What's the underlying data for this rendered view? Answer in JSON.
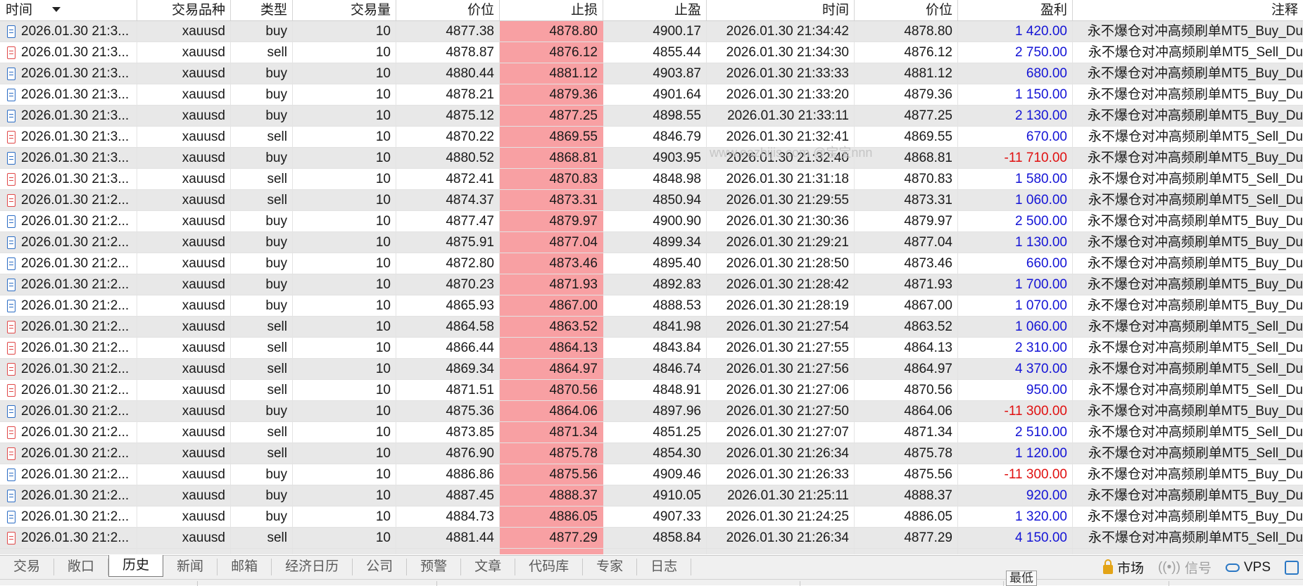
{
  "columns": {
    "time": "时间",
    "symbol": "交易品种",
    "type": "类型",
    "volume": "交易量",
    "price": "价位",
    "sl": "止损",
    "tp": "止盈",
    "close_time": "时间",
    "close_price": "价位",
    "profit": "盈利",
    "comment": "注释"
  },
  "watermark": "www.eazhijis.com @宝宝nnn",
  "rows": [
    {
      "time": "2026.01.30 21:3...",
      "symbol": "xauusd",
      "type": "buy",
      "volume": "10",
      "price": "4877.38",
      "sl": "4878.80",
      "tp": "4900.17",
      "close_time": "2026.01.30 21:34:42",
      "close_price": "4878.80",
      "profit": "1 420.00",
      "comment": "永不爆仓对冲高频刷单MT5_Buy_Du"
    },
    {
      "time": "2026.01.30 21:3...",
      "symbol": "xauusd",
      "type": "sell",
      "volume": "10",
      "price": "4878.87",
      "sl": "4876.12",
      "tp": "4855.44",
      "close_time": "2026.01.30 21:34:30",
      "close_price": "4876.12",
      "profit": "2 750.00",
      "comment": "永不爆仓对冲高频刷单MT5_Sell_Du"
    },
    {
      "time": "2026.01.30 21:3...",
      "symbol": "xauusd",
      "type": "buy",
      "volume": "10",
      "price": "4880.44",
      "sl": "4881.12",
      "tp": "4903.87",
      "close_time": "2026.01.30 21:33:33",
      "close_price": "4881.12",
      "profit": "680.00",
      "comment": "永不爆仓对冲高频刷单MT5_Buy_Du"
    },
    {
      "time": "2026.01.30 21:3...",
      "symbol": "xauusd",
      "type": "buy",
      "volume": "10",
      "price": "4878.21",
      "sl": "4879.36",
      "tp": "4901.64",
      "close_time": "2026.01.30 21:33:20",
      "close_price": "4879.36",
      "profit": "1 150.00",
      "comment": "永不爆仓对冲高频刷单MT5_Buy_Du"
    },
    {
      "time": "2026.01.30 21:3...",
      "symbol": "xauusd",
      "type": "buy",
      "volume": "10",
      "price": "4875.12",
      "sl": "4877.25",
      "tp": "4898.55",
      "close_time": "2026.01.30 21:33:11",
      "close_price": "4877.25",
      "profit": "2 130.00",
      "comment": "永不爆仓对冲高频刷单MT5_Buy_Du"
    },
    {
      "time": "2026.01.30 21:3...",
      "symbol": "xauusd",
      "type": "sell",
      "volume": "10",
      "price": "4870.22",
      "sl": "4869.55",
      "tp": "4846.79",
      "close_time": "2026.01.30 21:32:41",
      "close_price": "4869.55",
      "profit": "670.00",
      "comment": "永不爆仓对冲高频刷单MT5_Sell_Du"
    },
    {
      "time": "2026.01.30 21:3...",
      "symbol": "xauusd",
      "type": "buy",
      "volume": "10",
      "price": "4880.52",
      "sl": "4868.81",
      "tp": "4903.95",
      "close_time": "2026.01.30 21:32:40",
      "close_price": "4868.81",
      "profit": "-11 710.00",
      "comment": "永不爆仓对冲高频刷单MT5_Buy_Du"
    },
    {
      "time": "2026.01.30 21:3...",
      "symbol": "xauusd",
      "type": "sell",
      "volume": "10",
      "price": "4872.41",
      "sl": "4870.83",
      "tp": "4848.98",
      "close_time": "2026.01.30 21:31:18",
      "close_price": "4870.83",
      "profit": "1 580.00",
      "comment": "永不爆仓对冲高频刷单MT5_Sell_Du"
    },
    {
      "time": "2026.01.30 21:2...",
      "symbol": "xauusd",
      "type": "sell",
      "volume": "10",
      "price": "4874.37",
      "sl": "4873.31",
      "tp": "4850.94",
      "close_time": "2026.01.30 21:29:55",
      "close_price": "4873.31",
      "profit": "1 060.00",
      "comment": "永不爆仓对冲高频刷单MT5_Sell_Du"
    },
    {
      "time": "2026.01.30 21:2...",
      "symbol": "xauusd",
      "type": "buy",
      "volume": "10",
      "price": "4877.47",
      "sl": "4879.97",
      "tp": "4900.90",
      "close_time": "2026.01.30 21:30:36",
      "close_price": "4879.97",
      "profit": "2 500.00",
      "comment": "永不爆仓对冲高频刷单MT5_Buy_Du"
    },
    {
      "time": "2026.01.30 21:2...",
      "symbol": "xauusd",
      "type": "buy",
      "volume": "10",
      "price": "4875.91",
      "sl": "4877.04",
      "tp": "4899.34",
      "close_time": "2026.01.30 21:29:21",
      "close_price": "4877.04",
      "profit": "1 130.00",
      "comment": "永不爆仓对冲高频刷单MT5_Buy_Du"
    },
    {
      "time": "2026.01.30 21:2...",
      "symbol": "xauusd",
      "type": "buy",
      "volume": "10",
      "price": "4872.80",
      "sl": "4873.46",
      "tp": "4895.40",
      "close_time": "2026.01.30 21:28:50",
      "close_price": "4873.46",
      "profit": "660.00",
      "comment": "永不爆仓对冲高频刷单MT5_Buy_Du"
    },
    {
      "time": "2026.01.30 21:2...",
      "symbol": "xauusd",
      "type": "buy",
      "volume": "10",
      "price": "4870.23",
      "sl": "4871.93",
      "tp": "4892.83",
      "close_time": "2026.01.30 21:28:42",
      "close_price": "4871.93",
      "profit": "1 700.00",
      "comment": "永不爆仓对冲高频刷单MT5_Buy_Du"
    },
    {
      "time": "2026.01.30 21:2...",
      "symbol": "xauusd",
      "type": "buy",
      "volume": "10",
      "price": "4865.93",
      "sl": "4867.00",
      "tp": "4888.53",
      "close_time": "2026.01.30 21:28:19",
      "close_price": "4867.00",
      "profit": "1 070.00",
      "comment": "永不爆仓对冲高频刷单MT5_Buy_Du"
    },
    {
      "time": "2026.01.30 21:2...",
      "symbol": "xauusd",
      "type": "sell",
      "volume": "10",
      "price": "4864.58",
      "sl": "4863.52",
      "tp": "4841.98",
      "close_time": "2026.01.30 21:27:54",
      "close_price": "4863.52",
      "profit": "1 060.00",
      "comment": "永不爆仓对冲高频刷单MT5_Sell_Du"
    },
    {
      "time": "2026.01.30 21:2...",
      "symbol": "xauusd",
      "type": "sell",
      "volume": "10",
      "price": "4866.44",
      "sl": "4864.13",
      "tp": "4843.84",
      "close_time": "2026.01.30 21:27:55",
      "close_price": "4864.13",
      "profit": "2 310.00",
      "comment": "永不爆仓对冲高频刷单MT5_Sell_Du"
    },
    {
      "time": "2026.01.30 21:2...",
      "symbol": "xauusd",
      "type": "sell",
      "volume": "10",
      "price": "4869.34",
      "sl": "4864.97",
      "tp": "4846.74",
      "close_time": "2026.01.30 21:27:56",
      "close_price": "4864.97",
      "profit": "4 370.00",
      "comment": "永不爆仓对冲高频刷单MT5_Sell_Du"
    },
    {
      "time": "2026.01.30 21:2...",
      "symbol": "xauusd",
      "type": "sell",
      "volume": "10",
      "price": "4871.51",
      "sl": "4870.56",
      "tp": "4848.91",
      "close_time": "2026.01.30 21:27:06",
      "close_price": "4870.56",
      "profit": "950.00",
      "comment": "永不爆仓对冲高频刷单MT5_Sell_Du"
    },
    {
      "time": "2026.01.30 21:2...",
      "symbol": "xauusd",
      "type": "buy",
      "volume": "10",
      "price": "4875.36",
      "sl": "4864.06",
      "tp": "4897.96",
      "close_time": "2026.01.30 21:27:50",
      "close_price": "4864.06",
      "profit": "-11 300.00",
      "comment": "永不爆仓对冲高频刷单MT5_Buy_Du"
    },
    {
      "time": "2026.01.30 21:2...",
      "symbol": "xauusd",
      "type": "sell",
      "volume": "10",
      "price": "4873.85",
      "sl": "4871.34",
      "tp": "4851.25",
      "close_time": "2026.01.30 21:27:07",
      "close_price": "4871.34",
      "profit": "2 510.00",
      "comment": "永不爆仓对冲高频刷单MT5_Sell_Du"
    },
    {
      "time": "2026.01.30 21:2...",
      "symbol": "xauusd",
      "type": "sell",
      "volume": "10",
      "price": "4876.90",
      "sl": "4875.78",
      "tp": "4854.30",
      "close_time": "2026.01.30 21:26:34",
      "close_price": "4875.78",
      "profit": "1 120.00",
      "comment": "永不爆仓对冲高频刷单MT5_Sell_Du"
    },
    {
      "time": "2026.01.30 21:2...",
      "symbol": "xauusd",
      "type": "buy",
      "volume": "10",
      "price": "4886.86",
      "sl": "4875.56",
      "tp": "4909.46",
      "close_time": "2026.01.30 21:26:33",
      "close_price": "4875.56",
      "profit": "-11 300.00",
      "comment": "永不爆仓对冲高频刷单MT5_Buy_Du"
    },
    {
      "time": "2026.01.30 21:2...",
      "symbol": "xauusd",
      "type": "buy",
      "volume": "10",
      "price": "4887.45",
      "sl": "4888.37",
      "tp": "4910.05",
      "close_time": "2026.01.30 21:25:11",
      "close_price": "4888.37",
      "profit": "920.00",
      "comment": "永不爆仓对冲高频刷单MT5_Buy_Du"
    },
    {
      "time": "2026.01.30 21:2...",
      "symbol": "xauusd",
      "type": "buy",
      "volume": "10",
      "price": "4884.73",
      "sl": "4886.05",
      "tp": "4907.33",
      "close_time": "2026.01.30 21:24:25",
      "close_price": "4886.05",
      "profit": "1 320.00",
      "comment": "永不爆仓对冲高频刷单MT5_Buy_Du"
    },
    {
      "time": "2026.01.30 21:2...",
      "symbol": "xauusd",
      "type": "sell",
      "volume": "10",
      "price": "4881.44",
      "sl": "4877.29",
      "tp": "4858.84",
      "close_time": "2026.01.30 21:26:34",
      "close_price": "4877.29",
      "profit": "4 150.00",
      "comment": "永不爆仓对冲高频刷单MT5_Sell_Du"
    }
  ],
  "tabs": [
    "交易",
    "敞口",
    "历史",
    "新闻",
    "邮箱",
    "经济日历",
    "公司",
    "预警",
    "文章",
    "代码库",
    "专家",
    "日志"
  ],
  "active_tab": "历史",
  "status": {
    "market": "市场",
    "signals": "信号",
    "vps": "VPS",
    "tooltip": "最低"
  },
  "colors": {
    "sl_highlight": "#f8a0a3",
    "profit_positive": "#1414d6",
    "profit_negative": "#e01010",
    "buy_icon": "#2b6cc4",
    "sell_icon": "#e04848"
  }
}
